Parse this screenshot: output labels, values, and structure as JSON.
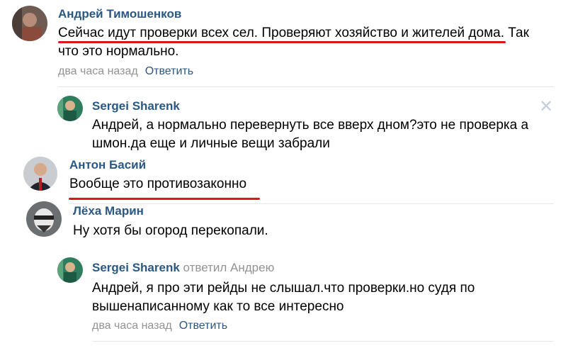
{
  "comments": [
    {
      "author": "Андрей Тимошенков",
      "text_line1": "Сейчас идут проверки всех сел. Проверяют хозяйство и жителей дома. Так",
      "text_line2": "что это нормально.",
      "time": "два часа назад",
      "reply_label": "Ответить"
    },
    {
      "author": "Sergei Sharenk",
      "text_line1": "Андрей, а нормально перевернуть все вверх дном?это не проверка а",
      "text_line2": "шмон.да еще и личные вещи забрали",
      "close_glyph": "✕"
    },
    {
      "author": "Антон Басий",
      "text": "Вообще это противозаконно"
    },
    {
      "author": "Лёха Марин",
      "text": "Ну хотя бы огород перекопали."
    },
    {
      "author": "Sergei Sharenk",
      "replied_to": "ответил Андрею",
      "text_line1": "Андрей, я про эти рейды не слышал.что проверки.но судя по",
      "text_line2": "вышенаписанному как то все интересно",
      "time": "два часа назад",
      "reply_label": "Ответить"
    }
  ],
  "colors": {
    "author": "#2a5885",
    "meta": "#939393",
    "underline": "#e0131f",
    "divider": "#e7e8ec"
  },
  "icons": [
    "avatar-andrey",
    "avatar-sergei",
    "avatar-anton",
    "avatar-lyokha",
    "close-icon"
  ]
}
